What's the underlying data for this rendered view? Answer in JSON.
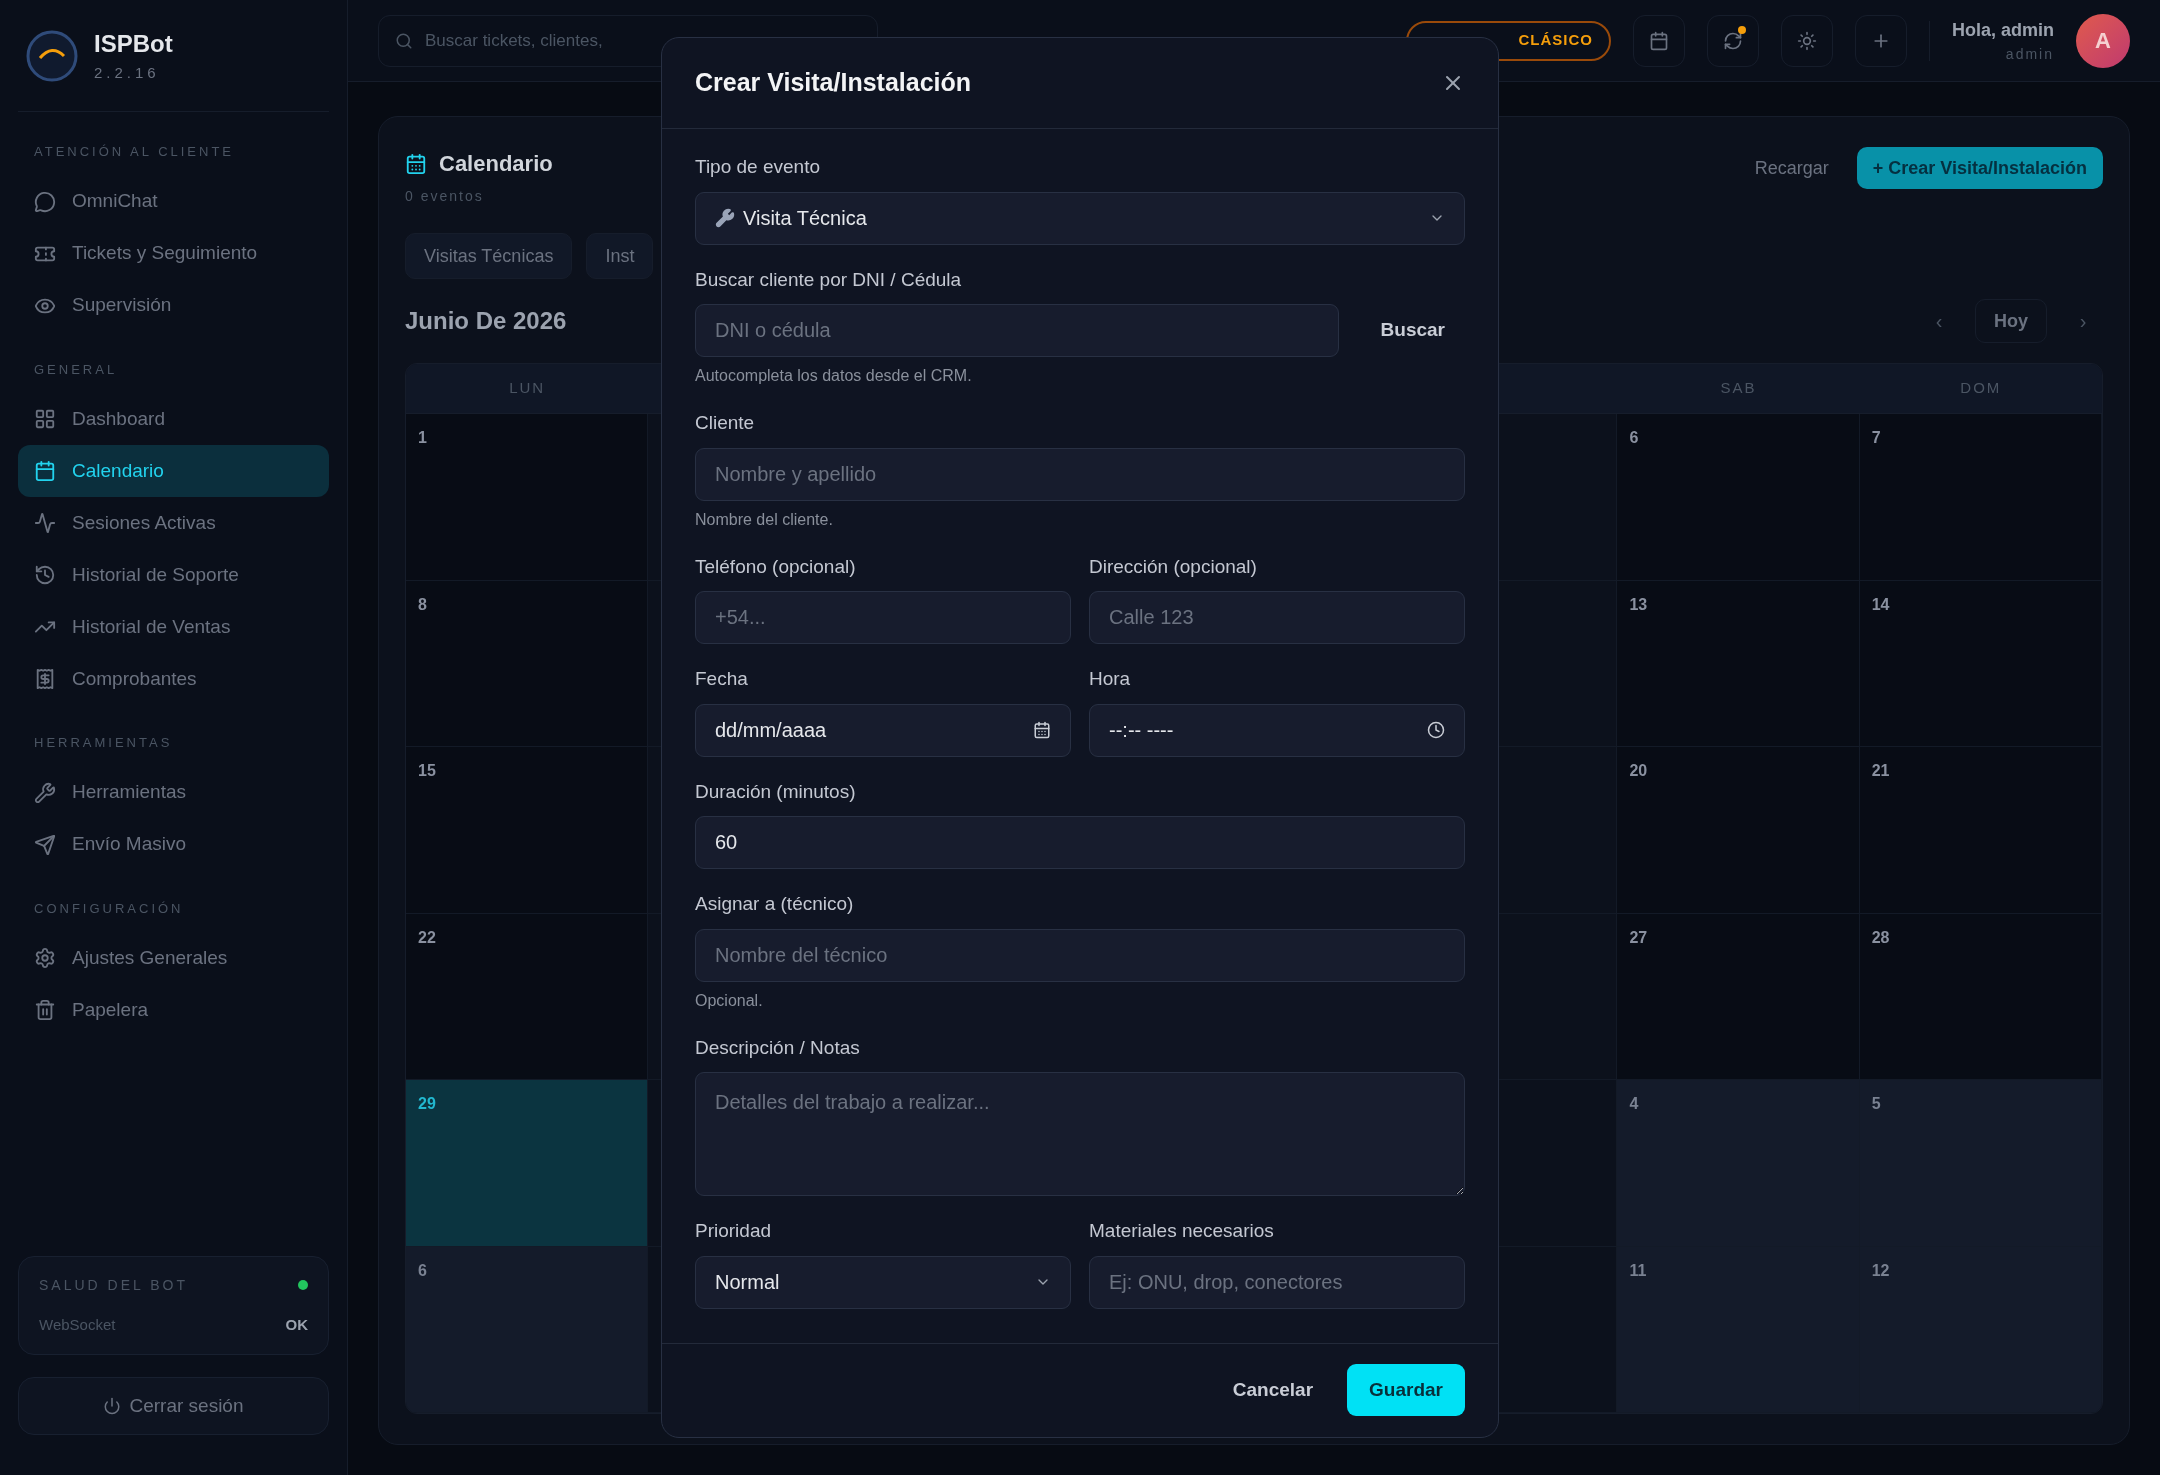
{
  "sidebar": {
    "brand": {
      "name": "ISPBot",
      "version": "2.2.16"
    },
    "sections": [
      {
        "title": "ATENCIÓN AL CLIENTE",
        "items": [
          {
            "label": "OmniChat",
            "selected": false
          },
          {
            "label": "Tickets y Seguimiento",
            "selected": false
          },
          {
            "label": "Supervisión",
            "selected": false
          }
        ]
      },
      {
        "title": "GENERAL",
        "items": [
          {
            "label": "Dashboard",
            "selected": false
          },
          {
            "label": "Calendario",
            "selected": true
          },
          {
            "label": "Sesiones Activas",
            "selected": false
          },
          {
            "label": "Historial de Soporte",
            "selected": false
          },
          {
            "label": "Historial de Ventas",
            "selected": false
          },
          {
            "label": "Comprobantes",
            "selected": false
          }
        ]
      },
      {
        "title": "HERRAMIENTAS",
        "items": [
          {
            "label": "Herramientas",
            "selected": false
          },
          {
            "label": "Envío Masivo",
            "selected": false
          }
        ]
      },
      {
        "title": "CONFIGURACIÓN",
        "items": [
          {
            "label": "Ajustes Generales",
            "selected": false
          },
          {
            "label": "Papelera",
            "selected": false
          }
        ]
      }
    ],
    "health": {
      "title": "SALUD DEL BOT",
      "color": "#22c55e",
      "label": "WebSocket",
      "value": "OK"
    },
    "logout": "Cerrar sesión"
  },
  "topbar": {
    "search_placeholder": "Buscar tickets, clientes,",
    "theme_badge": "CLÁSICO",
    "user": {
      "greeting": "Hola, admin",
      "role": "admin",
      "initial": "A"
    }
  },
  "calendar_page": {
    "title": "Calendario",
    "subtitle": "0 eventos",
    "reload": "Recargar",
    "create": "+ Crear Visita/Instalación",
    "filters": [
      "Visitas Técnicas",
      "Inst"
    ],
    "month": "Junio De 2026",
    "prev": "‹",
    "today": "Hoy",
    "next": "›",
    "weekdays": [
      "LUN",
      "SAB",
      "DOM"
    ],
    "weeks": [
      {
        "days": [
          {
            "date": "1",
            "today": false,
            "outside": false
          },
          {
            "date": "6",
            "today": false,
            "outside": false
          },
          {
            "date": "7",
            "today": false,
            "outside": false
          }
        ]
      },
      {
        "days": [
          {
            "date": "8",
            "today": false,
            "outside": false
          },
          {
            "date": "13",
            "today": false,
            "outside": false
          },
          {
            "date": "14",
            "today": false,
            "outside": false
          }
        ]
      },
      {
        "days": [
          {
            "date": "15",
            "today": false,
            "outside": false
          },
          {
            "date": "20",
            "today": false,
            "outside": false
          },
          {
            "date": "21",
            "today": false,
            "outside": false
          }
        ]
      },
      {
        "days": [
          {
            "date": "22",
            "today": false,
            "outside": false
          },
          {
            "date": "27",
            "today": false,
            "outside": false
          },
          {
            "date": "28",
            "today": false,
            "outside": false
          }
        ]
      },
      {
        "days": [
          {
            "date": "29",
            "today": true,
            "outside": false
          },
          {
            "date": "4",
            "today": false,
            "outside": true
          },
          {
            "date": "5",
            "today": false,
            "outside": true
          }
        ]
      },
      {
        "days": [
          {
            "date": "6",
            "today": false,
            "outside": true
          },
          {
            "date": "11",
            "today": false,
            "outside": true
          },
          {
            "date": "12",
            "today": false,
            "outside": true
          }
        ]
      }
    ]
  },
  "dialog": {
    "title": "Crear Visita/Instalación",
    "rows": [
      [
        {
          "kind": "event-select",
          "label": "Tipo de evento",
          "value": "Visita Técnica"
        }
      ],
      [
        {
          "kind": "search",
          "label": "Buscar cliente por DNI / Cédula",
          "placeholder": "DNI o cédula",
          "button": "Buscar",
          "hint": "Autocompleta los datos desde el CRM."
        }
      ],
      [
        {
          "kind": "text",
          "label": "Cliente",
          "placeholder": "Nombre y apellido",
          "hint": "Nombre del cliente."
        }
      ],
      [
        {
          "kind": "text",
          "label": "Teléfono (opcional)",
          "placeholder": "+54..."
        },
        {
          "kind": "text",
          "label": "Dirección (opcional)",
          "placeholder": "Calle 123"
        }
      ],
      [
        {
          "kind": "date",
          "label": "Fecha",
          "value": "dd/mm/aaaa"
        },
        {
          "kind": "time",
          "label": "Hora",
          "value": "--:-- ----"
        }
      ],
      [
        {
          "kind": "number",
          "label": "Duración (minutos)",
          "value": "60"
        }
      ],
      [
        {
          "kind": "text",
          "label": "Asignar a (técnico)",
          "placeholder": "Nombre del técnico",
          "hint": "Opcional."
        }
      ],
      [
        {
          "kind": "textarea",
          "label": "Descripción / Notas",
          "placeholder": "Detalles del trabajo a realizar..."
        }
      ],
      [
        {
          "kind": "select",
          "label": "Prioridad",
          "value": "Normal"
        },
        {
          "kind": "text",
          "label": "Materiales necesarios",
          "placeholder": "Ej: ONU, drop, conectores"
        }
      ]
    ],
    "cancel": "Cancelar",
    "save": "Guardar"
  }
}
